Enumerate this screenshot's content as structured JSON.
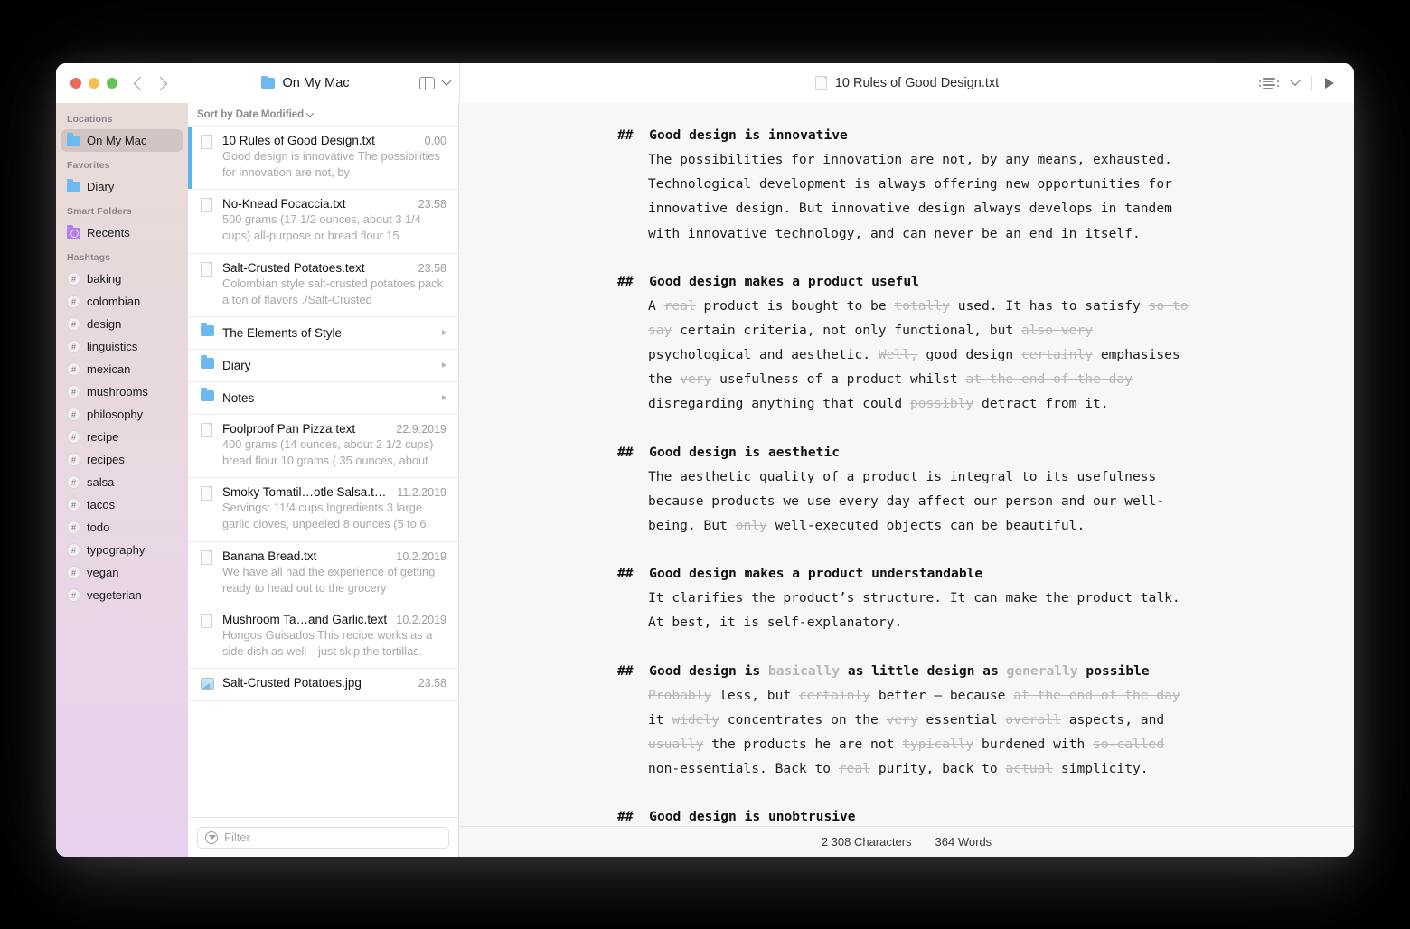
{
  "window": {
    "traffic_lights": [
      "close",
      "minimize",
      "zoom"
    ],
    "folder_title": "On My Mac",
    "document_title": "10 Rules of Good Design.txt"
  },
  "sidebar": {
    "sections": [
      {
        "title": "Locations",
        "items": [
          {
            "label": "On My Mac",
            "icon": "folder-icon",
            "selected": true
          }
        ]
      },
      {
        "title": "Favorites",
        "items": [
          {
            "label": "Diary",
            "icon": "folder-icon",
            "selected": false
          }
        ]
      },
      {
        "title": "Smart Folders",
        "items": [
          {
            "label": "Recents",
            "icon": "smart-folder-icon",
            "selected": false
          }
        ]
      },
      {
        "title": "Hashtags",
        "items": [
          {
            "label": "baking",
            "icon": "hashtag-icon",
            "selected": false
          },
          {
            "label": "colombian",
            "icon": "hashtag-icon",
            "selected": false
          },
          {
            "label": "design",
            "icon": "hashtag-icon",
            "selected": false
          },
          {
            "label": "linguistics",
            "icon": "hashtag-icon",
            "selected": false
          },
          {
            "label": "mexican",
            "icon": "hashtag-icon",
            "selected": false
          },
          {
            "label": "mushrooms",
            "icon": "hashtag-icon",
            "selected": false
          },
          {
            "label": "philosophy",
            "icon": "hashtag-icon",
            "selected": false
          },
          {
            "label": "recipe",
            "icon": "hashtag-icon",
            "selected": false
          },
          {
            "label": "recipes",
            "icon": "hashtag-icon",
            "selected": false
          },
          {
            "label": "salsa",
            "icon": "hashtag-icon",
            "selected": false
          },
          {
            "label": "tacos",
            "icon": "hashtag-icon",
            "selected": false
          },
          {
            "label": "todo",
            "icon": "hashtag-icon",
            "selected": false
          },
          {
            "label": "typography",
            "icon": "hashtag-icon",
            "selected": false
          },
          {
            "label": "vegan",
            "icon": "hashtag-icon",
            "selected": false
          },
          {
            "label": "vegeterian",
            "icon": "hashtag-icon",
            "selected": false
          }
        ]
      }
    ],
    "hash_glyph": "#"
  },
  "filelist": {
    "sort_label": "Sort by Date Modified",
    "rows": [
      {
        "kind": "document",
        "name": "10 Rules of Good Design.txt",
        "date": "0.00",
        "preview": "Good design is innovative The possibilities for innovation are not, by",
        "selected": true
      },
      {
        "kind": "document",
        "name": "No-Knead Focaccia.txt",
        "date": "23.58",
        "preview": "500 grams (17 1/2 ounces, about 3 1/4 cups) all-purpose or bread flour 15",
        "selected": false
      },
      {
        "kind": "document",
        "name": "Salt-Crusted Potatoes.text",
        "date": "23.58",
        "preview": "Colombian style salt-crusted potatoes pack a ton of flavors ./Salt-Crusted",
        "selected": false
      },
      {
        "kind": "folder",
        "name": "The Elements of Style",
        "date": "",
        "preview": "",
        "selected": false
      },
      {
        "kind": "folder",
        "name": "Diary",
        "date": "",
        "preview": "",
        "selected": false
      },
      {
        "kind": "folder",
        "name": "Notes",
        "date": "",
        "preview": "",
        "selected": false
      },
      {
        "kind": "document",
        "name": "Foolproof Pan Pizza.text",
        "date": "22.9.2019",
        "preview": "400 grams (14 ounces, about 2 1/2 cups) bread flour 10 grams (.35 ounces, about",
        "selected": false
      },
      {
        "kind": "document",
        "name": "Smoky Tomatil…otle Salsa.text",
        "date": "11.2.2019",
        "preview": "Servings: 11/4 cups Ingredients 3 large garlic cloves, unpeeled 8 ounces (5 to 6",
        "selected": false
      },
      {
        "kind": "document",
        "name": "Banana Bread.txt",
        "date": "10.2.2019",
        "preview": "We have all had the experience of getting ready to head out to the grocery",
        "selected": false
      },
      {
        "kind": "document",
        "name": "Mushroom Ta…and Garlic.text",
        "date": "10.2.2019",
        "preview": "Hongos Guisados This recipe works as a side dish as well—just skip the tortillas.",
        "selected": false
      },
      {
        "kind": "image",
        "name": "Salt-Crusted Potatoes.jpg",
        "date": "23.58",
        "preview": "",
        "selected": false
      }
    ],
    "filter_placeholder": "Filter"
  },
  "editor": {
    "hashes": "##",
    "sections": [
      {
        "heading_runs": [
          {
            "t": "Good design is innovative",
            "strike": false
          }
        ],
        "body_runs": [
          {
            "t": "The possibilities for innovation are not, by any means, exhausted. Technological development is always offering new opportunities for innovative design. But innovative design always develops in tandem with innovative technology, and can never be an end in itself.",
            "strike": false
          }
        ],
        "caret": true
      },
      {
        "heading_runs": [
          {
            "t": "Good design makes a product useful",
            "strike": false
          }
        ],
        "body_runs": [
          {
            "t": "A ",
            "strike": false
          },
          {
            "t": "real",
            "strike": true
          },
          {
            "t": " product is bought to be ",
            "strike": false
          },
          {
            "t": "totally",
            "strike": true
          },
          {
            "t": " used. It has to satisfy ",
            "strike": false
          },
          {
            "t": "so to say",
            "strike": true
          },
          {
            "t": " certain criteria, not only functional, but ",
            "strike": false
          },
          {
            "t": "also very",
            "strike": true
          },
          {
            "t": " psychological and aesthetic. ",
            "strike": false
          },
          {
            "t": "Well,",
            "strike": true
          },
          {
            "t": " good design ",
            "strike": false
          },
          {
            "t": "certainly",
            "strike": true
          },
          {
            "t": " emphasises the ",
            "strike": false
          },
          {
            "t": "very",
            "strike": true
          },
          {
            "t": " usefulness of a product whilst ",
            "strike": false
          },
          {
            "t": "at the end of the day",
            "strike": true
          },
          {
            "t": " disregarding anything that could ",
            "strike": false
          },
          {
            "t": "possibly",
            "strike": true
          },
          {
            "t": " detract from it.",
            "strike": false
          }
        ],
        "caret": false
      },
      {
        "heading_runs": [
          {
            "t": "Good design is aesthetic",
            "strike": false
          }
        ],
        "body_runs": [
          {
            "t": "The aesthetic quality of a product is integral to its usefulness because products we use every day affect our person and our well-being. But ",
            "strike": false
          },
          {
            "t": "only",
            "strike": true
          },
          {
            "t": " well-executed objects can be beautiful.",
            "strike": false
          }
        ],
        "caret": false
      },
      {
        "heading_runs": [
          {
            "t": "Good design makes a product understandable",
            "strike": false
          }
        ],
        "body_runs": [
          {
            "t": "It clarifies the product’s structure. It can make the product talk. At best, it is self-explanatory.",
            "strike": false
          }
        ],
        "caret": false
      },
      {
        "heading_runs": [
          {
            "t": "Good design is ",
            "strike": false
          },
          {
            "t": "basically",
            "strike": true
          },
          {
            "t": " as little design as ",
            "strike": false
          },
          {
            "t": "generally",
            "strike": true
          },
          {
            "t": " possible",
            "strike": false
          }
        ],
        "body_runs": [
          {
            "t": "Probably",
            "strike": true
          },
          {
            "t": " less, but ",
            "strike": false
          },
          {
            "t": "certainly",
            "strike": true
          },
          {
            "t": " better – because ",
            "strike": false
          },
          {
            "t": "at the end of the day",
            "strike": true
          },
          {
            "t": " it ",
            "strike": false
          },
          {
            "t": "widely",
            "strike": true
          },
          {
            "t": " concentrates on the ",
            "strike": false
          },
          {
            "t": "very",
            "strike": true
          },
          {
            "t": " essential ",
            "strike": false
          },
          {
            "t": "overall",
            "strike": true
          },
          {
            "t": " aspects, and ",
            "strike": false
          },
          {
            "t": "usually",
            "strike": true
          },
          {
            "t": " the products he are not ",
            "strike": false
          },
          {
            "t": "typically",
            "strike": true
          },
          {
            "t": " burdened with ",
            "strike": false
          },
          {
            "t": "so-called",
            "strike": true
          },
          {
            "t": " non-essentials. Back to ",
            "strike": false
          },
          {
            "t": "real",
            "strike": true
          },
          {
            "t": " purity, back to ",
            "strike": false
          },
          {
            "t": "actual",
            "strike": true
          },
          {
            "t": " simplicity.",
            "strike": false
          }
        ],
        "caret": false
      },
      {
        "heading_runs": [
          {
            "t": "Good design is unobtrusive",
            "strike": false
          }
        ],
        "body_runs": [],
        "caret": false
      }
    ]
  },
  "statusbar": {
    "characters": "2 308 Characters",
    "words": "364 Words"
  },
  "colors": {
    "accent_blue": "#5ab4e6",
    "caret_blue": "#3f9fe0",
    "sidebar_top": "#e8dcd8",
    "sidebar_bottom": "#e6d2ec",
    "editor_bg": "#f7f7f7"
  }
}
